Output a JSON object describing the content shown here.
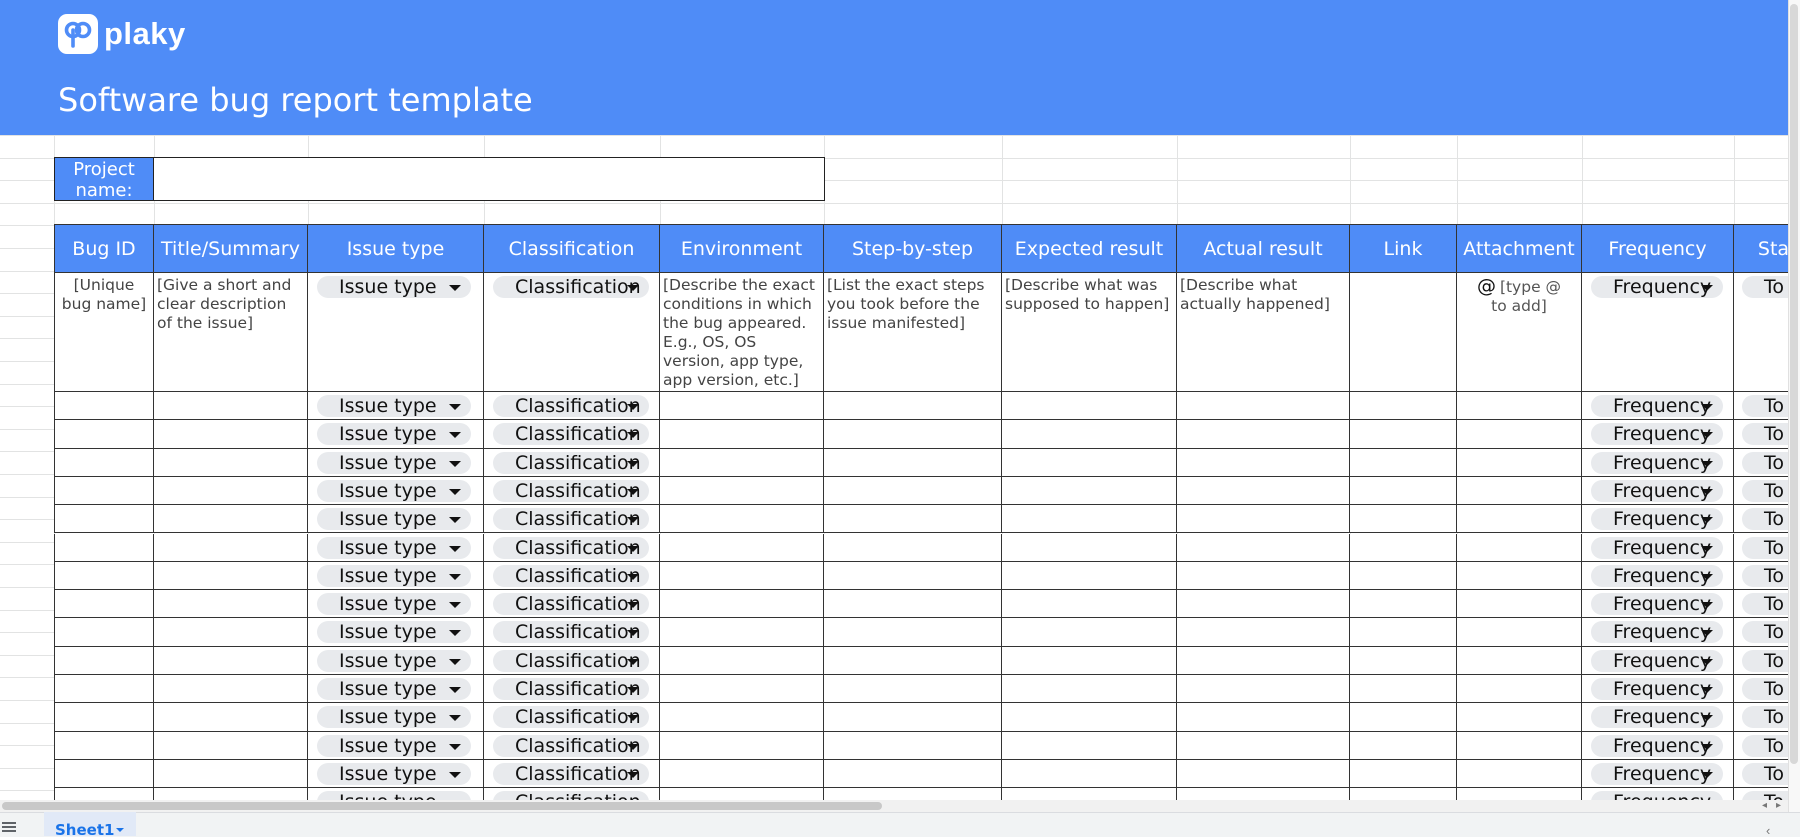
{
  "app": {
    "logo_text": "plaky",
    "title": "Software bug report template"
  },
  "project": {
    "label": "Project name:",
    "value": ""
  },
  "table": {
    "headers": [
      "Bug ID",
      "Title/Summary",
      "Issue type",
      "Classification",
      "Environment",
      "Step-by-step",
      "Expected result",
      "Actual result",
      "Link",
      "Attachment",
      "Frequency",
      "Sta"
    ],
    "first_row": {
      "bug_id": "[Unique bug name]",
      "title": "[Give a short and clear description of the issue]",
      "issue_type": "Issue type",
      "classification": "Classification",
      "environment": "[Describe the exact conditions in which the bug appeared. E.g., OS, OS version, app type, app version, etc.]",
      "steps": "[List the exact steps you took before the issue manifested]",
      "expected": "[Describe what was supposed to happen]",
      "actual": "[Describe what actually happened]",
      "link": "",
      "attachment_icon": "@",
      "attachment": "[type @ to add]",
      "frequency": "Frequency",
      "status": "To d"
    },
    "empty_row_chips": {
      "issue_type": "Issue type",
      "classification": "Classification",
      "frequency": "Frequency",
      "status": "To d"
    },
    "empty_row_count": 15
  },
  "sheet_tabs": [
    {
      "label": "Sheet1",
      "active": true
    }
  ],
  "colors": {
    "banner": "#4f8cf7",
    "header": "#4f8cf7",
    "chip": "#e8eaed",
    "tab_text": "#1a73e8"
  }
}
